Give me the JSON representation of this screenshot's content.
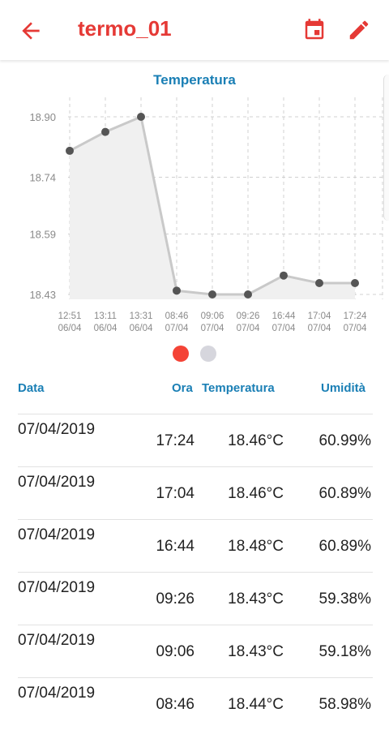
{
  "appbar": {
    "title": "termo_01"
  },
  "chart": {
    "title": "Temperatura"
  },
  "chart_data": {
    "type": "line",
    "title": "Temperatura",
    "x": [
      "12:51\n06/04",
      "13:11\n06/04",
      "13:31\n06/04",
      "08:46\n07/04",
      "09:06\n07/04",
      "09:26\n07/04",
      "16:44\n07/04",
      "17:04\n07/04",
      "17:24\n07/04"
    ],
    "series": [
      {
        "values": [
          18.81,
          18.86,
          18.9,
          18.44,
          18.43,
          18.43,
          18.48,
          18.46,
          18.46
        ]
      }
    ],
    "yticks": [
      "18.90",
      "18.74",
      "18.59",
      "18.43"
    ],
    "ylim": [
      18.43,
      18.9
    ],
    "grid": true,
    "colors": {
      "line": "#c9c9c9",
      "point": "#555555",
      "fill": "#f0f0f0",
      "grid": "#d0d0d0"
    }
  },
  "pager": {
    "pages": 2,
    "active": 0
  },
  "table": {
    "headers": {
      "data": "Data",
      "ora": "Ora",
      "temp": "Temperatura",
      "umid": "Umidità"
    },
    "rows": [
      {
        "data": "07/04/2019",
        "ora": "17:24",
        "temp": "18.46°C",
        "umid": "60.99%"
      },
      {
        "data": "07/04/2019",
        "ora": "17:04",
        "temp": "18.46°C",
        "umid": "60.89%"
      },
      {
        "data": "07/04/2019",
        "ora": "16:44",
        "temp": "18.48°C",
        "umid": "60.89%"
      },
      {
        "data": "07/04/2019",
        "ora": "09:26",
        "temp": "18.43°C",
        "umid": "59.38%"
      },
      {
        "data": "07/04/2019",
        "ora": "09:06",
        "temp": "18.43°C",
        "umid": "59.18%"
      },
      {
        "data": "07/04/2019",
        "ora": "08:46",
        "temp": "18.44°C",
        "umid": "58.98%"
      }
    ]
  },
  "colors": {
    "accent": "#e53935",
    "header_text": "#1a7fb5"
  }
}
